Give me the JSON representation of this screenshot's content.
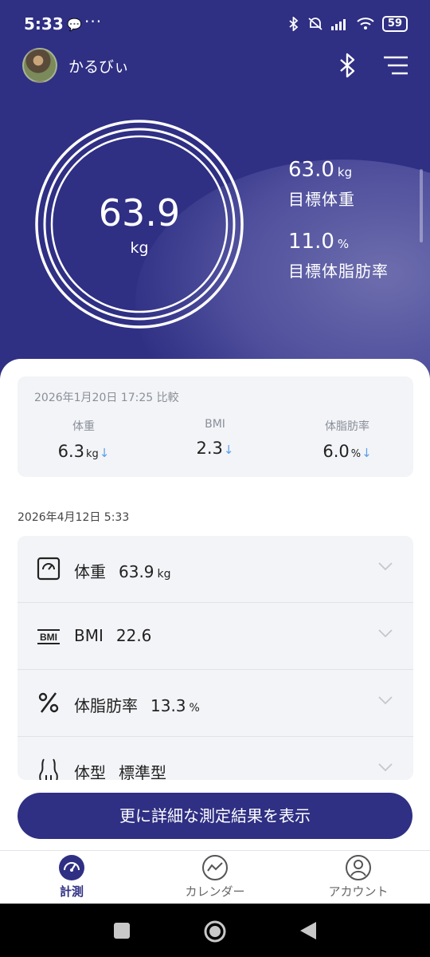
{
  "status_bar": {
    "time": "5:33",
    "battery": "59"
  },
  "header": {
    "user_name": "かるびぃ",
    "gauge_value": "63.9",
    "gauge_unit": "kg",
    "goals": [
      {
        "value": "63.0",
        "unit": "kg",
        "label": "目標体重"
      },
      {
        "value": "11.0",
        "unit": "%",
        "label": "目標体脂肪率"
      }
    ]
  },
  "comparison": {
    "title": "2026年1月20日 17:25 比較",
    "items": [
      {
        "label": "体重",
        "value": "6.3",
        "unit": "kg",
        "arrow": "↓"
      },
      {
        "label": "BMI",
        "value": "2.3",
        "unit": "",
        "arrow": "↓"
      },
      {
        "label": "体脂肪率",
        "value": "6.0",
        "unit": "%",
        "arrow": "↓"
      }
    ]
  },
  "measurement": {
    "date": "2026年4月12日 5:33",
    "rows": [
      {
        "icon": "scale-icon",
        "name": "体重",
        "value": "63.9",
        "unit": "kg"
      },
      {
        "icon": "bmi-icon",
        "name": "BMI",
        "value": "22.6",
        "unit": ""
      },
      {
        "icon": "percent-icon",
        "name": "体脂肪率",
        "value": "13.3",
        "unit": "%"
      },
      {
        "icon": "body-shape-icon",
        "name": "体型",
        "value": "標準型",
        "unit": ""
      }
    ]
  },
  "cta": {
    "label": "更に詳細な測定結果を表示"
  },
  "tabs": [
    {
      "label": "計測",
      "icon": "gauge-icon",
      "active": true
    },
    {
      "label": "カレンダー",
      "icon": "trend-icon",
      "active": false
    },
    {
      "label": "アカウント",
      "icon": "account-icon",
      "active": false
    }
  ],
  "colors": {
    "primary": "#2f2f84",
    "accent_arrow": "#5aa0ea"
  }
}
